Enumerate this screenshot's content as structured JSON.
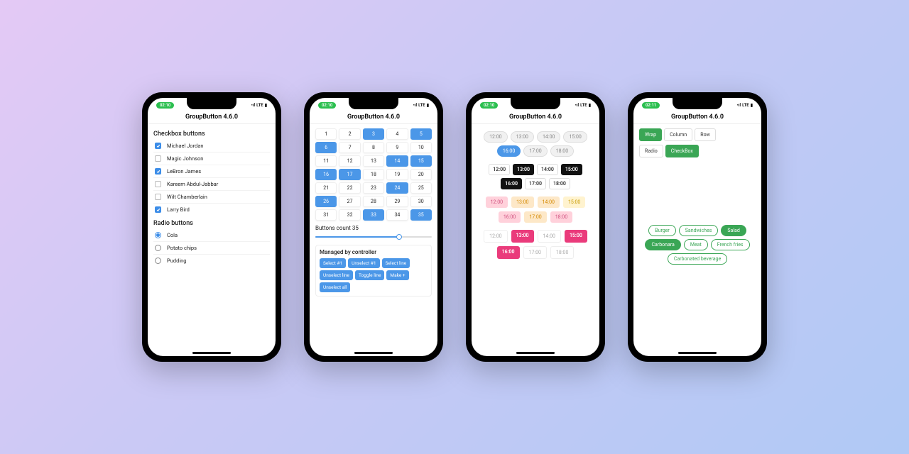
{
  "status": {
    "time1": "02:10",
    "time2": "02:10",
    "time3": "02:10",
    "time4": "02:11",
    "network": "LTE"
  },
  "app_title": "GroupButton 4.6.0",
  "screen1": {
    "checkbox_header": "Checkbox buttons",
    "checkbox_items": [
      {
        "label": "Michael Jordan",
        "checked": true
      },
      {
        "label": "Magic Johnson",
        "checked": false
      },
      {
        "label": "LeBron James",
        "checked": true
      },
      {
        "label": "Kareem Abdul-Jabbar",
        "checked": false
      },
      {
        "label": "Wilt Chamberlain",
        "checked": false
      },
      {
        "label": "Larry Bird",
        "checked": true
      }
    ],
    "radio_header": "Radio buttons",
    "radio_items": [
      {
        "label": "Cola",
        "checked": true
      },
      {
        "label": "Potato chips",
        "checked": false
      },
      {
        "label": "Pudding",
        "checked": false
      }
    ]
  },
  "screen2": {
    "numbers": [
      1,
      2,
      3,
      4,
      5,
      6,
      7,
      8,
      9,
      10,
      11,
      12,
      13,
      14,
      15,
      16,
      17,
      18,
      19,
      20,
      21,
      22,
      23,
      24,
      25,
      26,
      27,
      28,
      29,
      30,
      31,
      32,
      33,
      34,
      35
    ],
    "selected": [
      3,
      5,
      6,
      14,
      15,
      16,
      17,
      24,
      26,
      33,
      35
    ],
    "slider_label": "Buttons count 35",
    "slider_value_pct": 72,
    "controller_header": "Managed by controller",
    "controller_buttons": [
      "Select #1",
      "Unselect #1",
      "Select line",
      "Unselect line",
      "Toggle line",
      "Make +",
      "Unselect all"
    ]
  },
  "screen3": {
    "rowA": [
      "12:00",
      "13:00",
      "14:00",
      "15:00",
      "16:00",
      "17:00",
      "18:00"
    ],
    "rowA_selected": "16:00",
    "rowB": [
      "12:00",
      "13:00",
      "14:00",
      "15:00",
      "16:00",
      "17:00",
      "18:00"
    ],
    "rowB_selected": [
      "13:00",
      "15:00",
      "16:00"
    ],
    "rowC": [
      "12:00",
      "13:00",
      "14:00",
      "15:00",
      "16:00",
      "17:00",
      "18:00"
    ],
    "rowC_highlight": "16:00",
    "rowD": [
      "12:00",
      "13:00",
      "14:00",
      "15:00",
      "16:00",
      "17:00",
      "18:00"
    ],
    "rowD_selected": [
      "13:00",
      "15:00",
      "16:00"
    ]
  },
  "screen4": {
    "segA": [
      {
        "label": "Wrap",
        "on": true
      },
      {
        "label": "Column",
        "on": false
      },
      {
        "label": "Row",
        "on": false
      }
    ],
    "segB": [
      {
        "label": "Radio",
        "on": false
      },
      {
        "label": "CheckBox",
        "on": true
      }
    ],
    "foods": [
      {
        "label": "Burger",
        "on": false
      },
      {
        "label": "Sandwiches",
        "on": false
      },
      {
        "label": "Salad",
        "on": true
      },
      {
        "label": "Carbonara",
        "on": true
      },
      {
        "label": "Meat",
        "on": false
      },
      {
        "label": "French fries",
        "on": false
      },
      {
        "label": "Carbonated beverage",
        "on": false
      }
    ]
  }
}
